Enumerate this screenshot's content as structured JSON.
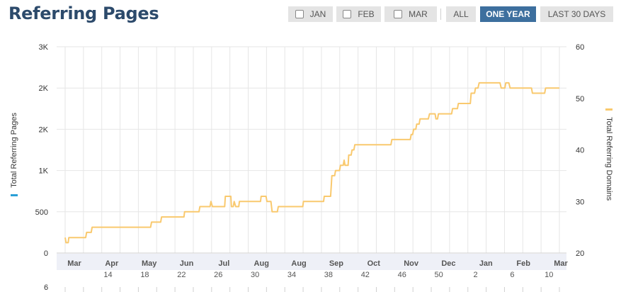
{
  "page": {
    "title": "Referring Pages"
  },
  "toolbar": {
    "jan": "JAN",
    "feb": "FEB",
    "mar": "MAR",
    "all": "ALL",
    "one_year": "ONE YEAR",
    "last_30_days": "LAST 30 DAYS"
  },
  "colors": {
    "line": "#f9c96e",
    "left_accent": "#2a9fd6",
    "right_accent": "#f9c96e",
    "active": "#3d6f9e"
  },
  "chart_data": {
    "type": "line",
    "ylabel_left": "Total Referring Pages",
    "ylabel_right": "Total Referring Domains",
    "yticks_left": [
      "0",
      "500",
      "1K",
      "2K",
      "2K",
      "3K"
    ],
    "yticks_right": [
      "20",
      "30",
      "40",
      "50",
      "60"
    ],
    "ylim_right": [
      20,
      60
    ],
    "xticks_month": [
      "Mar",
      "Apr",
      "May",
      "Jun",
      "Jul",
      "Aug",
      "Aug",
      "Sep",
      "Oct",
      "Nov",
      "Dec",
      "Jan",
      "Feb",
      "Mar"
    ],
    "xticks_week": [
      "14",
      "18",
      "22",
      "26",
      "30",
      "34",
      "38",
      "42",
      "46",
      "50",
      "2",
      "6",
      "10"
    ],
    "below_label": "6",
    "series": [
      {
        "axis": "right",
        "points": [
          [
            0,
            23
          ],
          [
            0.3,
            22
          ],
          [
            1,
            22
          ],
          [
            1.2,
            23
          ],
          [
            6.7,
            23
          ],
          [
            7,
            24
          ],
          [
            8.5,
            24
          ],
          [
            8.8,
            25
          ],
          [
            27.9,
            25
          ],
          [
            28.2,
            26
          ],
          [
            31.2,
            26
          ],
          [
            31.5,
            27
          ],
          [
            38.8,
            27
          ],
          [
            39,
            28
          ],
          [
            43.7,
            28
          ],
          [
            44,
            29
          ],
          [
            47.3,
            29
          ],
          [
            47.6,
            30
          ],
          [
            48.1,
            29
          ],
          [
            52.1,
            29
          ],
          [
            52.3,
            31
          ],
          [
            54.1,
            31
          ],
          [
            54.3,
            29
          ],
          [
            54.9,
            29
          ],
          [
            55.2,
            30
          ],
          [
            55.7,
            29
          ],
          [
            56.7,
            29
          ],
          [
            56.9,
            30
          ],
          [
            63.8,
            30
          ],
          [
            64,
            31
          ],
          [
            65.6,
            31
          ],
          [
            65.9,
            30
          ],
          [
            67.2,
            30
          ],
          [
            67.6,
            28
          ],
          [
            69.3,
            28
          ],
          [
            69.6,
            29
          ],
          [
            77.6,
            29
          ],
          [
            77.8,
            30
          ],
          [
            84.4,
            30
          ],
          [
            84.6,
            31
          ],
          [
            86.7,
            31
          ],
          [
            87.1,
            35
          ],
          [
            88,
            35
          ],
          [
            88.3,
            36
          ],
          [
            89.6,
            36
          ],
          [
            89.9,
            37
          ],
          [
            90.8,
            37
          ],
          [
            91.1,
            38
          ],
          [
            91.4,
            37
          ],
          [
            92.4,
            37
          ],
          [
            92.6,
            39
          ],
          [
            93.4,
            39
          ],
          [
            93.7,
            40
          ],
          [
            94.3,
            40
          ],
          [
            94.6,
            41
          ],
          [
            106.4,
            41
          ],
          [
            106.7,
            42
          ],
          [
            112.7,
            42
          ],
          [
            113,
            43
          ],
          [
            113.5,
            43
          ],
          [
            113.8,
            44
          ],
          [
            114.5,
            44
          ],
          [
            114.8,
            45
          ],
          [
            115.6,
            45
          ],
          [
            115.9,
            46
          ],
          [
            118.6,
            46
          ],
          [
            119,
            47
          ],
          [
            120.8,
            47
          ],
          [
            121.1,
            46
          ],
          [
            121.6,
            46
          ],
          [
            121.9,
            47
          ],
          [
            126.2,
            47
          ],
          [
            126.5,
            48
          ],
          [
            128.1,
            48
          ],
          [
            128.4,
            49
          ],
          [
            132.3,
            49
          ],
          [
            132.6,
            51
          ],
          [
            133.7,
            51
          ],
          [
            134,
            52
          ],
          [
            134.8,
            52
          ],
          [
            135.2,
            53
          ],
          [
            142,
            53
          ],
          [
            142.4,
            52
          ],
          [
            143.6,
            52
          ],
          [
            143.9,
            53
          ],
          [
            144.9,
            53
          ],
          [
            145.3,
            52
          ],
          [
            152.3,
            52
          ],
          [
            152.6,
            51
          ],
          [
            156.6,
            51
          ],
          [
            156.9,
            52
          ],
          [
            161.4,
            52
          ]
        ]
      }
    ]
  }
}
